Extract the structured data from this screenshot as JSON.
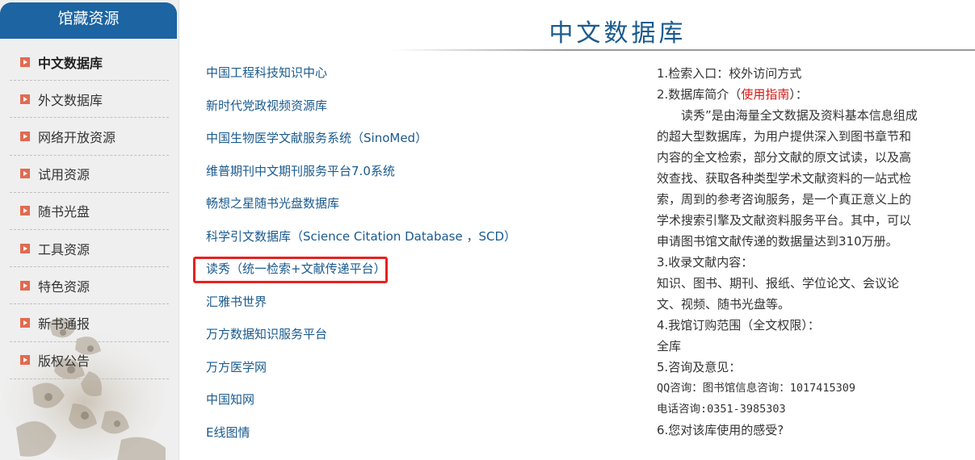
{
  "sidebar": {
    "header": "馆藏资源",
    "items": [
      {
        "label": "中文数据库",
        "active": true
      },
      {
        "label": "外文数据库"
      },
      {
        "label": "网络开放资源"
      },
      {
        "label": "试用资源"
      },
      {
        "label": "随书光盘"
      },
      {
        "label": "工具资源"
      },
      {
        "label": "特色资源"
      },
      {
        "label": "新书通报"
      },
      {
        "label": "版权公告"
      }
    ]
  },
  "main": {
    "title": "中文数据库",
    "databases": [
      "中国工程科技知识中心",
      "新时代党政视频资源库",
      "中国生物医学文献服务系统（SinoMed）",
      "维普期刊中文期刊服务平台7.0系统",
      "畅想之星随书光盘数据库",
      "科学引文数据库（Science Citation Database ，SCD）",
      "读秀（统一检索+文献传递平台）",
      "汇雅书世界",
      "万方数据知识服务平台",
      "万方医学网",
      "中国知网",
      "E线图情"
    ],
    "highlighted_index": 6
  },
  "info": {
    "line1": "1.检索入口：校外访问方式",
    "line2_prefix": "2.数据库简介（",
    "line2_link": "使用指南",
    "line2_suffix": "）：",
    "intro": "读秀”是由海量全文数据及资料基本信息组成的超大型数据库，为用户提供深入到图书章节和内容的全文检索，部分文献的原文试读，以及高效查找、获取各种类型学术文献资料的一站式检索，周到的参考咨询服务，是一个真正意义上的学术搜索引擎及文献资料服务平台。其中，可以申请图书馆文献传递的数据量达到310万册。",
    "line3": "3.收录文献内容：",
    "content": "知识、图书、期刊、报纸、学位论文、会议论文、视频、随书光盘等。",
    "line4": "4.我馆订购范围（全文权限）：",
    "scope": "全库",
    "line5": "5.咨询及意见：",
    "qq": "QQ咨询：图书馆信息咨询：1017415309",
    "phone": "电话咨询:0351-3985303",
    "line6": "6.您对该库使用的感受?"
  },
  "colors": {
    "header_blue": "#1c64a2",
    "link_blue": "#1a5a8e",
    "bullet": "#e26a50",
    "highlight_border": "#e8211d",
    "guide_link": "#d31a14"
  }
}
